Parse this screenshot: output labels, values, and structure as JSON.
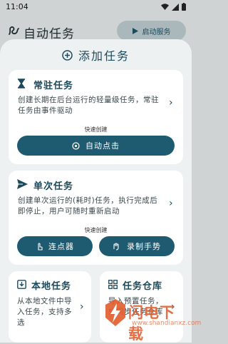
{
  "status_bar": {
    "time": "11:04"
  },
  "app_bar": {
    "title": "自动任务",
    "start_button": "启动服务"
  },
  "sheet": {
    "title": "添加任务",
    "resident_card": {
      "title": "常驻任务",
      "description": "创建长期在后台运行的轻量级任务，常驻任务由事件驱动",
      "quick_create_label": "快速创建",
      "auto_click_button": "自动点击"
    },
    "single_card": {
      "title": "单次任务",
      "description": "创建单次运行的(耗时)任务，执行完成后即停止，用户可随时重新启动",
      "quick_create_label": "快速创建",
      "clicker_button": "连点器",
      "record_gesture_button": "录制手势"
    },
    "local_card": {
      "title": "本地任务",
      "description": "从本地文件中导入任务，支持多选"
    },
    "repo_card": {
      "title": "任务仓库",
      "description": "导入预置任务，或同步任务仓库"
    }
  },
  "watermark": {
    "text": "闪电下载",
    "url": "www.shandianxz.com"
  },
  "colors": {
    "accent": "#1e5b70",
    "sheet_bg": "#eef1f2",
    "scrim": "#cfd3d3"
  }
}
